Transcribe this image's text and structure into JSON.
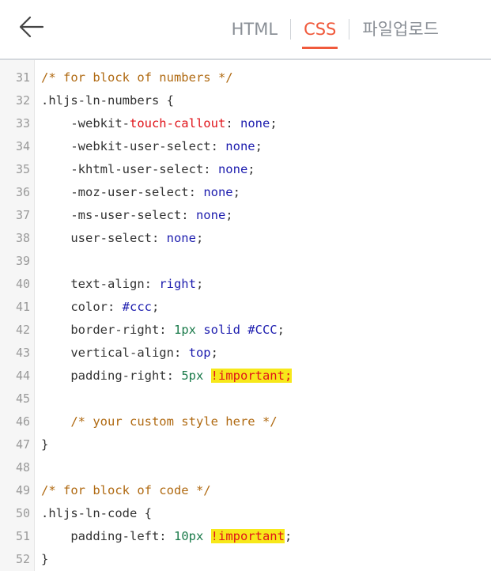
{
  "header": {
    "back_icon": "arrow-left-icon",
    "tabs": [
      {
        "label": "HTML",
        "active": false
      },
      {
        "label": "CSS",
        "active": true
      },
      {
        "label": "파일업로드",
        "active": false
      }
    ]
  },
  "colors": {
    "accent": "#f05a3c",
    "comment": "#b06a12",
    "keyword": "#1c1cae",
    "number": "#1a7a4a",
    "highlight": "#f7e81a"
  },
  "lines": [
    {
      "n": "31",
      "t": "/* for block of numbers */"
    },
    {
      "n": "32",
      "t": ".hljs-ln-numbers {"
    },
    {
      "n": "33",
      "t": "    -webkit-touch-callout: none;"
    },
    {
      "n": "34",
      "t": "    -webkit-user-select: none;"
    },
    {
      "n": "35",
      "t": "    -khtml-user-select: none;"
    },
    {
      "n": "36",
      "t": "    -moz-user-select: none;"
    },
    {
      "n": "37",
      "t": "    -ms-user-select: none;"
    },
    {
      "n": "38",
      "t": "    user-select: none;"
    },
    {
      "n": "39",
      "t": ""
    },
    {
      "n": "40",
      "t": "    text-align: right;"
    },
    {
      "n": "41",
      "t": "    color: #ccc;"
    },
    {
      "n": "42",
      "t": "    border-right: 1px solid #CCC;"
    },
    {
      "n": "43",
      "t": "    vertical-align: top;"
    },
    {
      "n": "44",
      "t": "    padding-right: 5px !important;"
    },
    {
      "n": "45",
      "t": ""
    },
    {
      "n": "46",
      "t": "    /* your custom style here */"
    },
    {
      "n": "47",
      "t": "}"
    },
    {
      "n": "48",
      "t": ""
    },
    {
      "n": "49",
      "t": "/* for block of code */"
    },
    {
      "n": "50",
      "t": ".hljs-ln-code {"
    },
    {
      "n": "51",
      "t": "    padding-left: 10px !important;"
    },
    {
      "n": "52",
      "t": "}"
    }
  ],
  "tokens": {
    "c31": "/* for block of numbers */",
    "s32": ".hljs-ln-numbers {",
    "p33a": "    -webkit-",
    "p33b": "touch-callout",
    "p33c": ": ",
    "v33": "none",
    "e33": ";",
    "p34": "    -webkit-user-select: ",
    "v34": "none",
    "e34": ";",
    "p35": "    -khtml-user-select: ",
    "v35": "none",
    "e35": ";",
    "p36": "    -moz-user-select: ",
    "v36": "none",
    "e36": ";",
    "p37": "    -ms-user-select: ",
    "v37": "none",
    "e37": ";",
    "p38": "    user-select: ",
    "v38": "none",
    "e38": ";",
    "p40": "    text-align: ",
    "v40": "right",
    "e40": ";",
    "p41": "    color: ",
    "v41": "#ccc",
    "e41": ";",
    "p42": "    border-right: ",
    "n42": "1px",
    "v42": " solid #CCC",
    "e42": ";",
    "p43": "    vertical-align: ",
    "v43": "top",
    "e43": ";",
    "p44": "    padding-right: ",
    "n44": "5px",
    "sp44": " ",
    "h44": "!important;",
    "c46": "    /* your custom style here */",
    "b47": "}",
    "c49": "/* for block of code */",
    "s50": ".hljs-ln-code {",
    "p51": "    padding-left: ",
    "n51": "10px",
    "sp51": " ",
    "h51": "!important",
    "e51": ";",
    "b52": "}"
  }
}
